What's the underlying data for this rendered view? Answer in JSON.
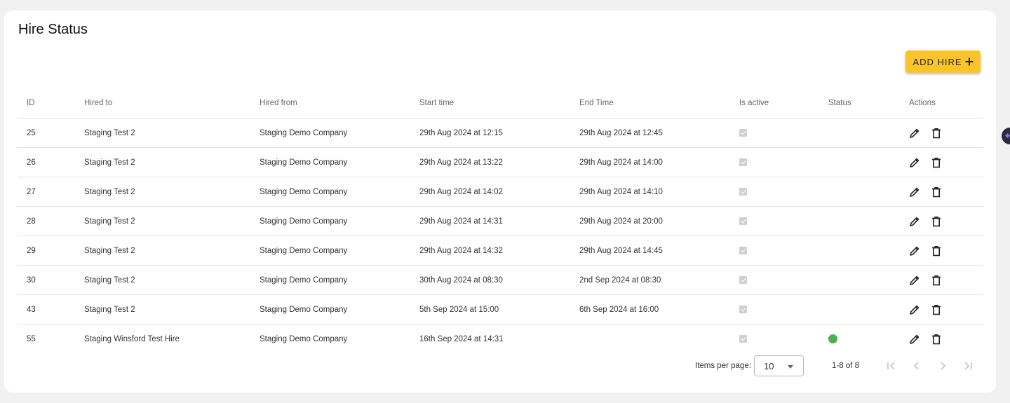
{
  "page": {
    "title": "Hire Status",
    "add_button": "ADD HIRE"
  },
  "table": {
    "headers": {
      "id": "ID",
      "hired_to": "Hired to",
      "hired_from": "Hired from",
      "start_time": "Start time",
      "end_time": "End Time",
      "is_active": "Is active",
      "status": "Status",
      "actions": "Actions"
    },
    "rows": [
      {
        "id": "25",
        "hired_to": "Staging Test 2",
        "hired_from": "Staging Demo Company",
        "start_time": "29th Aug 2024 at 12:15",
        "end_time": "29th Aug 2024 at 12:45",
        "is_active": true,
        "status": ""
      },
      {
        "id": "26",
        "hired_to": "Staging Test 2",
        "hired_from": "Staging Demo Company",
        "start_time": "29th Aug 2024 at 13:22",
        "end_time": "29th Aug 2024 at 14:00",
        "is_active": true,
        "status": ""
      },
      {
        "id": "27",
        "hired_to": "Staging Test 2",
        "hired_from": "Staging Demo Company",
        "start_time": "29th Aug 2024 at 14:02",
        "end_time": "29th Aug 2024 at 14:10",
        "is_active": true,
        "status": ""
      },
      {
        "id": "28",
        "hired_to": "Staging Test 2",
        "hired_from": "Staging Demo Company",
        "start_time": "29th Aug 2024 at 14:31",
        "end_time": "29th Aug 2024 at 20:00",
        "is_active": true,
        "status": ""
      },
      {
        "id": "29",
        "hired_to": "Staging Test 2",
        "hired_from": "Staging Demo Company",
        "start_time": "29th Aug 2024 at 14:32",
        "end_time": "29th Aug 2024 at 14:45",
        "is_active": true,
        "status": ""
      },
      {
        "id": "30",
        "hired_to": "Staging Test 2",
        "hired_from": "Staging Demo Company",
        "start_time": "30th Aug 2024 at 08:30",
        "end_time": "2nd Sep 2024 at 08:30",
        "is_active": true,
        "status": ""
      },
      {
        "id": "43",
        "hired_to": "Staging Test 2",
        "hired_from": "Staging Demo Company",
        "start_time": "5th Sep 2024 at 15:00",
        "end_time": "6th Sep 2024 at 16:00",
        "is_active": true,
        "status": ""
      },
      {
        "id": "55",
        "hired_to": "Staging Winsford Test Hire",
        "hired_from": "Staging Demo Company",
        "start_time": "16th Sep 2024 at 14:31",
        "end_time": "",
        "is_active": true,
        "status": "green"
      }
    ]
  },
  "paginator": {
    "items_per_page_label": "Items per page:",
    "items_per_page_value": "10",
    "range_label": "1-8 of 8"
  },
  "colors": {
    "accent_button": "#fbc42a",
    "status_green": "#4caf50"
  }
}
